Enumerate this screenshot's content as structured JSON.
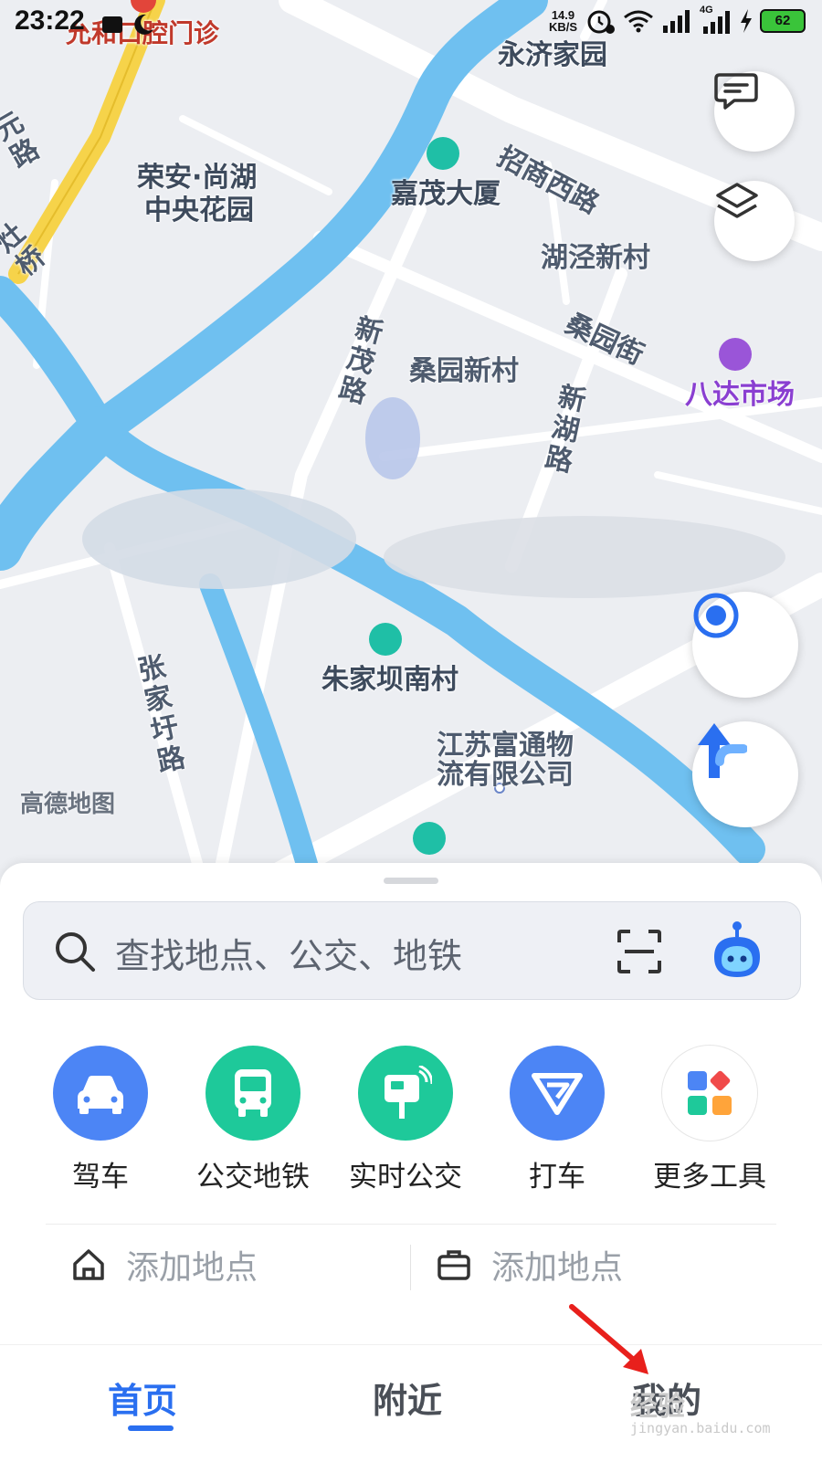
{
  "status_bar": {
    "time": "23:22",
    "net_speed_value": "14.9",
    "net_speed_unit": "KB/S",
    "network_type": "4G",
    "battery": "62"
  },
  "map": {
    "labels": {
      "clinic": "允和口腔门诊",
      "yongji": "永济家园",
      "zhaoshang_road": "招商西路",
      "rongan": "荣安·尚湖",
      "rongan2": "中央花园",
      "jiamao": "嘉茂大厦",
      "huxing": "湖泾新村",
      "sangyuan_street": "桑园街",
      "bada": "八达市场",
      "xinmao_road": "新茂路",
      "sangyuan_village": "桑园新村",
      "xinhu_road": "新湖路",
      "zhujiaba": "朱家坝南村",
      "zhangjiayu_road": "张家圩路",
      "jiangsu_futong_1": "江苏富通物",
      "jiangsu_futong_2": "流有限公司",
      "left_road_fragment": "元路",
      "bridge_fragment": "灶桥"
    },
    "watermark": "高德地图"
  },
  "search": {
    "placeholder": "查找地点、公交、地铁"
  },
  "tools": [
    {
      "label": "驾车",
      "color": "#4c85f5",
      "icon": "car-icon"
    },
    {
      "label": "公交地铁",
      "color": "#1ec99a",
      "icon": "bus-icon"
    },
    {
      "label": "实时公交",
      "color": "#1ec99a",
      "icon": "bus-stop-icon"
    },
    {
      "label": "打车",
      "color": "#4c85f5",
      "icon": "taxi-icon"
    },
    {
      "label": "更多工具",
      "color": "#ffffff",
      "icon": "grid-apps-icon"
    }
  ],
  "places": {
    "home": "添加地点",
    "work": "添加地点"
  },
  "tabs": {
    "home": "首页",
    "nearby": "附近",
    "mine": "我的"
  },
  "overlay": {
    "watermark": "经验",
    "watermark_url": "jingyan.baidu.com"
  }
}
